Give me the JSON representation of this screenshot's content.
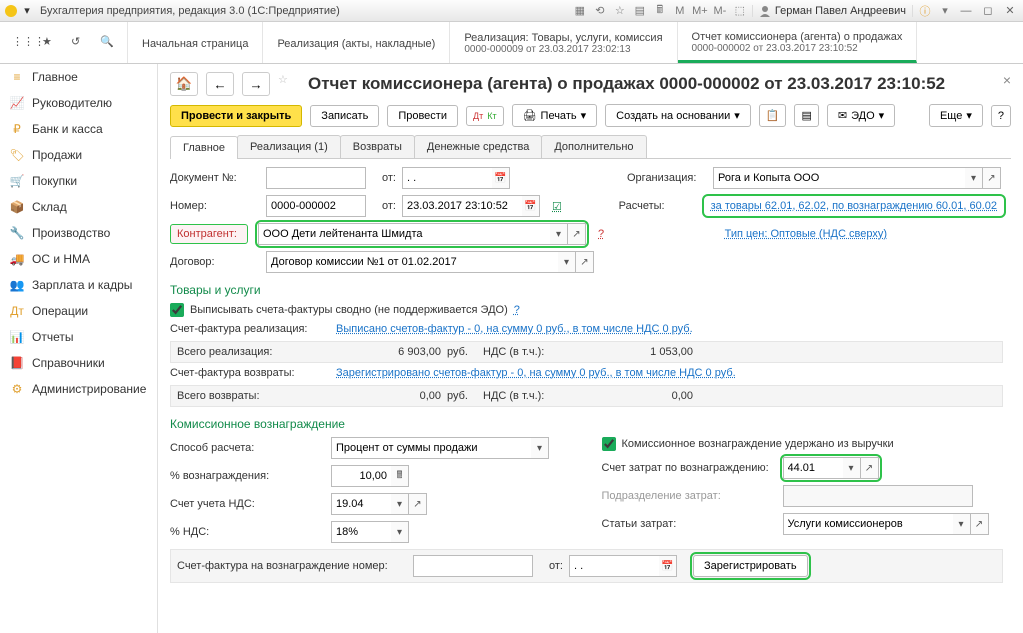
{
  "titlebar": {
    "app_title": "Бухгалтерия предприятия, редакция 3.0  (1С:Предприятие)",
    "user_name": "Герман Павел Андреевич"
  },
  "top_tabs": {
    "start": "Начальная страница",
    "t1": "Реализация (акты, накладные)",
    "t2_line1": "Реализация: Товары, услуги, комиссия",
    "t2_line2": "0000-000009 от 23.03.2017 23:02:13",
    "t3_line1": "Отчет комиссионера (агента) о продажах",
    "t3_line2": "0000-000002 от 23.03.2017 23:10:52"
  },
  "sidebar": {
    "items": [
      {
        "label": "Главное"
      },
      {
        "label": "Руководителю"
      },
      {
        "label": "Банк и касса"
      },
      {
        "label": "Продажи"
      },
      {
        "label": "Покупки"
      },
      {
        "label": "Склад"
      },
      {
        "label": "Производство"
      },
      {
        "label": "ОС и НМА"
      },
      {
        "label": "Зарплата и кадры"
      },
      {
        "label": "Операции"
      },
      {
        "label": "Отчеты"
      },
      {
        "label": "Справочники"
      },
      {
        "label": "Администрирование"
      }
    ]
  },
  "page": {
    "title": "Отчет комиссионера (агента) о продажах 0000-000002 от 23.03.2017 23:10:52"
  },
  "toolbar": {
    "submit_close": "Провести и закрыть",
    "write": "Записать",
    "submit": "Провести",
    "print": "Печать",
    "create_based": "Создать на основании",
    "edo": "ЭДО",
    "more": "Еще"
  },
  "form_tabs": {
    "main": "Главное",
    "real": "Реализация (1)",
    "returns": "Возвраты",
    "money": "Денежные средства",
    "extra": "Дополнительно"
  },
  "fields": {
    "doc_num_label": "Документ №:",
    "doc_num": "",
    "from_label": "от:",
    "doc_date": ". .",
    "num_label": "Номер:",
    "num": "0000-000002",
    "num_date": "23.03.2017 23:10:52",
    "org_label": "Организация:",
    "org": "Рога и Копыта ООО",
    "calc_label": "Расчеты:",
    "calc_link": "за товары 62.01, 62.02, по вознаграждению 60.01, 60.02",
    "contr_label": "Контрагент:",
    "contr": "ООО Дети лейтенанта Шмидта",
    "price_type_link": "Тип цен: Оптовые (НДС сверху)",
    "contract_label": "Договор:",
    "contract": "Договор комиссии №1 от 01.02.2017"
  },
  "goods": {
    "header": "Товары и услуги",
    "cb_label": "Выписывать счета-фактуры сводно (не поддерживается ЭДО)",
    "sf_real_label": "Счет-фактура реализация:",
    "sf_real_link": "Выписано счетов-фактур - 0, на сумму 0 руб., в том числе НДС 0 руб.",
    "total_real_label": "Всего реализация:",
    "total_real_amount": "6 903,00",
    "rub": "руб.",
    "nds_incl": "НДС (в т.ч.):",
    "total_real_nds": "1 053,00",
    "sf_ret_label": "Счет-фактура возвраты:",
    "sf_ret_link": "Зарегистрировано счетов-фактур - 0, на сумму 0 руб., в том числе НДС 0 руб.",
    "total_ret_label": "Всего возвраты:",
    "total_ret_amount": "0,00",
    "total_ret_nds": "0,00"
  },
  "commission": {
    "header": "Комиссионное вознаграждение",
    "method_label": "Способ расчета:",
    "method": "Процент от суммы продажи",
    "withheld_label": "Комиссионное вознаграждение удержано из выручки",
    "pct_label": "% вознаграждения:",
    "pct": "10,00",
    "acc_exp_label": "Счет затрат по вознаграждению:",
    "acc_exp": "44.01",
    "acc_nds_label": "Счет учета НДС:",
    "acc_nds": "19.04",
    "dept_label": "Подразделение затрат:",
    "dept": "",
    "nds_pct_label": "% НДС:",
    "nds_pct": "18%",
    "exp_item_label": "Статьи затрат:",
    "exp_item": "Услуги комиссионеров",
    "sf_num_label": "Счет-фактура на вознаграждение номер:",
    "sf_num": "",
    "sf_from": "от:",
    "sf_date": ". .",
    "register": "Зарегистрировать"
  }
}
